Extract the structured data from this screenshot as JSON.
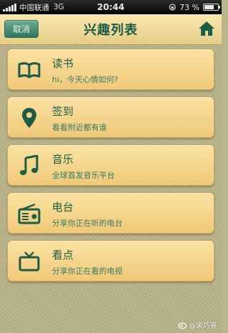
{
  "status_bar": {
    "carrier": "中国联通",
    "network": "3G",
    "time": "20:44",
    "battery_percent": "73 %",
    "battery_level": 0.73
  },
  "nav": {
    "cancel_label": "取消",
    "title": "兴趣列表",
    "home_icon": "home-icon"
  },
  "items": [
    {
      "title": "读书",
      "subtitle": "hi，今天心情如何?",
      "icon": "book-icon"
    },
    {
      "title": "签到",
      "subtitle": "看看附近都有谁",
      "icon": "location-pin-icon"
    },
    {
      "title": "音乐",
      "subtitle": "全球首发音乐平台",
      "icon": "music-note-icon"
    },
    {
      "title": "电台",
      "subtitle": "分享你正在听的电台",
      "icon": "radio-icon"
    },
    {
      "title": "看点",
      "subtitle": "分享你正在看的电视",
      "icon": "tv-icon"
    }
  ],
  "watermark": "@宋巧亮",
  "colors": {
    "accent": "#1f5a44",
    "card_bg": "#f5d68f",
    "nav_bg": "#efdb9c",
    "cancel_bg": "#4e8f76"
  }
}
